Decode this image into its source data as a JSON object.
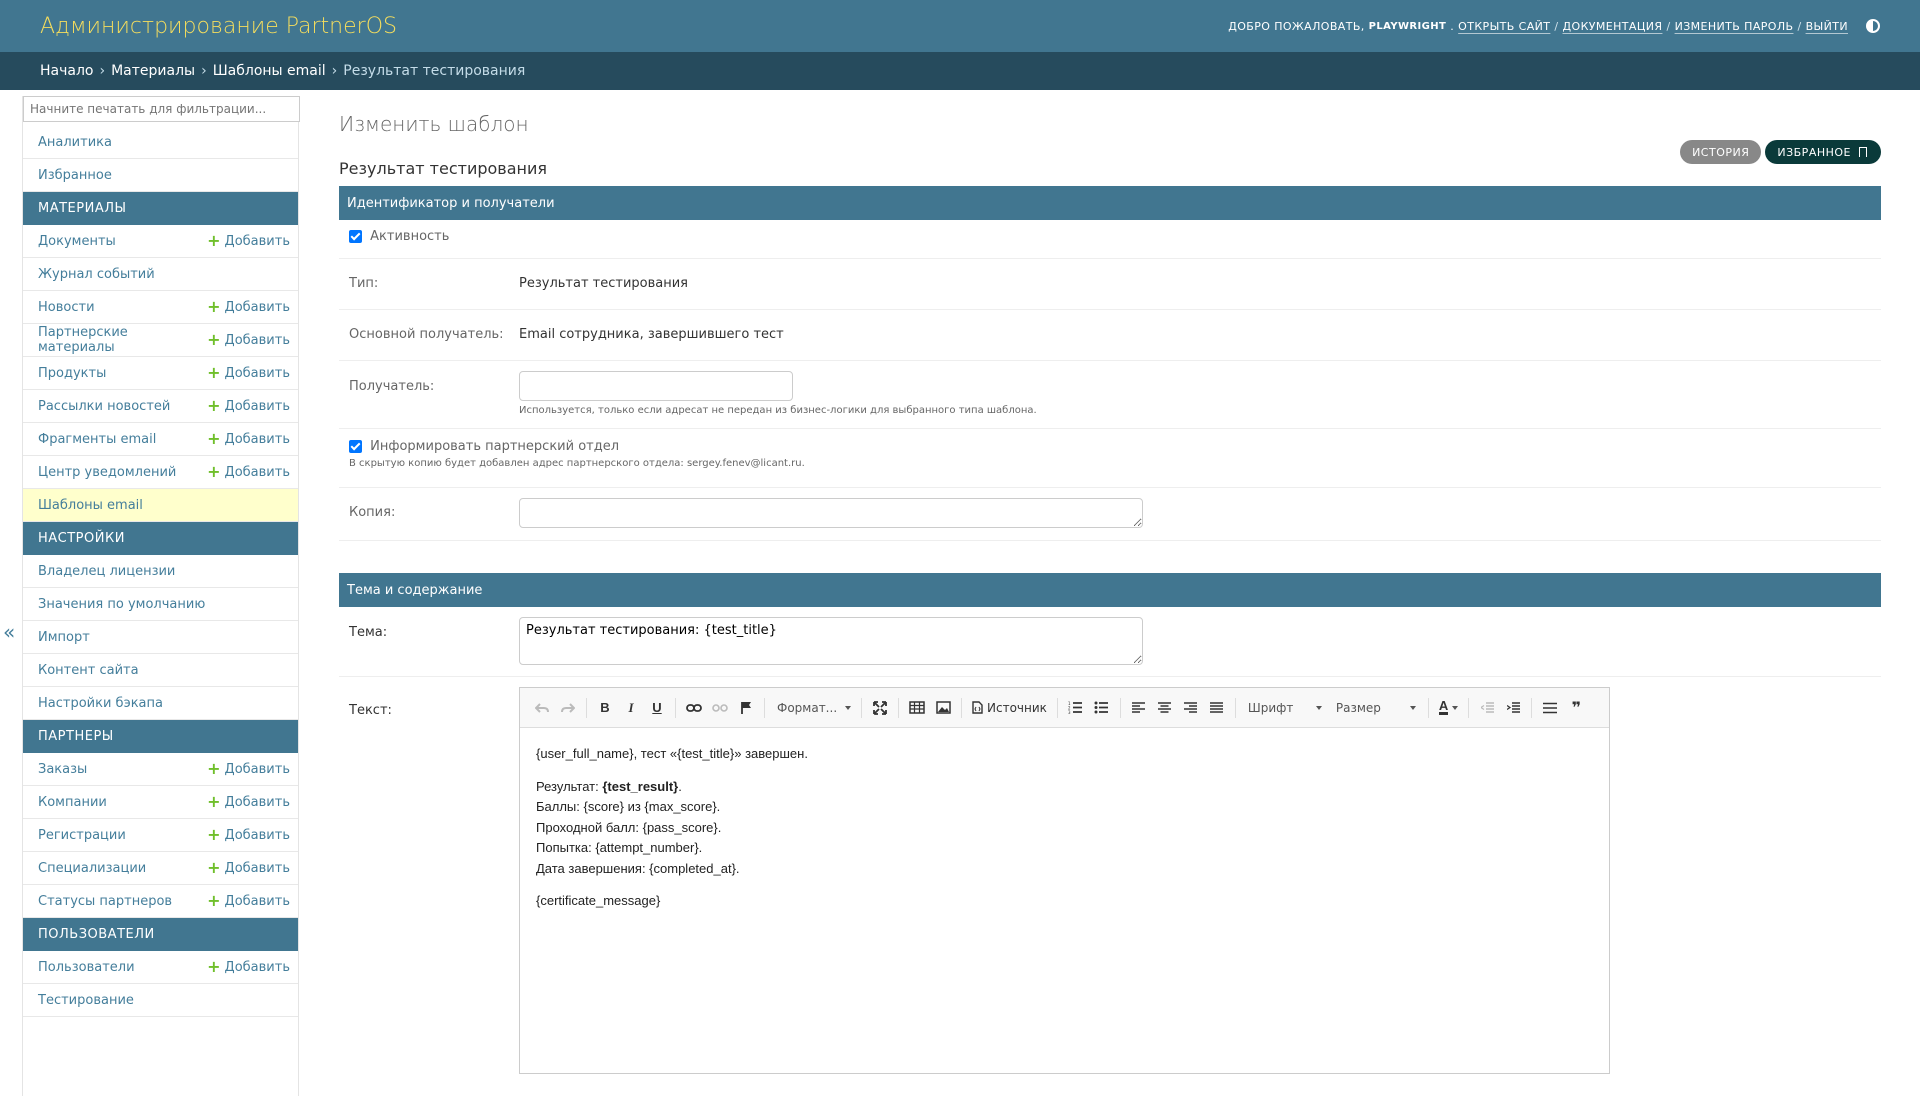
{
  "header": {
    "site_name": "Администрирование PartnerOS",
    "welcome": "Добро пожаловать,",
    "username": "PLAYWRIGHT",
    "links": [
      "Открыть сайт",
      "Документация",
      "Изменить пароль",
      "Выйти"
    ]
  },
  "breadcrumbs": [
    "Начало",
    "Материалы",
    "Шаблоны email",
    "Результат тестирования"
  ],
  "sidebar": {
    "filter_placeholder": "Начните печатать для фильтрации...",
    "add_label": "Добавить",
    "top_items": [
      {
        "label": "Аналитика"
      },
      {
        "label": "Избранное"
      }
    ],
    "sections": [
      {
        "title": "Материалы",
        "items": [
          {
            "label": "Документы",
            "add": true
          },
          {
            "label": "Журнал событий",
            "add": false
          },
          {
            "label": "Новости",
            "add": true
          },
          {
            "label": "Партнерские материалы",
            "add": true
          },
          {
            "label": "Продукты",
            "add": true
          },
          {
            "label": "Рассылки новостей",
            "add": true
          },
          {
            "label": "Фрагменты email",
            "add": true
          },
          {
            "label": "Центр уведомлений",
            "add": true
          },
          {
            "label": "Шаблоны email",
            "add": false,
            "current": true
          }
        ]
      },
      {
        "title": "Настройки",
        "items": [
          {
            "label": "Владелец лицензии",
            "add": false
          },
          {
            "label": "Значения по умолчанию",
            "add": false
          },
          {
            "label": "Импорт",
            "add": false
          },
          {
            "label": "Контент сайта",
            "add": false
          },
          {
            "label": "Настройки бэкапа",
            "add": false
          }
        ]
      },
      {
        "title": "Партнеры",
        "items": [
          {
            "label": "Заказы",
            "add": true
          },
          {
            "label": "Компании",
            "add": true
          },
          {
            "label": "Регистрации",
            "add": true
          },
          {
            "label": "Специализации",
            "add": true
          },
          {
            "label": "Статусы партнеров",
            "add": true
          }
        ]
      },
      {
        "title": "Пользователи",
        "items": [
          {
            "label": "Пользователи",
            "add": true
          },
          {
            "label": "Тестирование",
            "add": false
          }
        ]
      }
    ],
    "toggle": "«"
  },
  "content": {
    "title": "Изменить шаблон",
    "subtitle": "Результат тестирования",
    "object_tools": {
      "history": "История",
      "favorite": "Избранное"
    },
    "fieldset1": {
      "title": "Идентификатор и получатели",
      "active_label": "Активность",
      "active_checked": true,
      "type_label": "Тип:",
      "type_value": "Результат тестирования",
      "main_recipient_label": "Основной получатель:",
      "main_recipient_value": "Email сотрудника, завершившего тест",
      "recipient_label": "Получатель:",
      "recipient_value": "",
      "recipient_help": "Используется, только если адресат не передан из бизнес-логики для выбранного типа шаблона.",
      "inform_label": "Информировать партнерский отдел",
      "inform_checked": true,
      "inform_help": "В скрытую копию будет добавлен адрес партнерского отдела: sergey.fenev@licant.ru.",
      "cc_label": "Копия:",
      "cc_value": ""
    },
    "fieldset2": {
      "title": "Тема и содержание",
      "subject_label": "Тема:",
      "subject_value": "Результат тестирования: {test_title}",
      "text_label": "Текст:"
    }
  },
  "editor": {
    "toolbar": {
      "bold": "B",
      "italic": "I",
      "underline": "U",
      "format": "Формат...",
      "source": "Источник",
      "font": "Шрифт",
      "size": "Размер",
      "text_color": "A",
      "quote": "❞"
    },
    "body": {
      "line1": "{user_full_name}, тест «{test_title}» завершен.",
      "result_prefix": "Результат: ",
      "result_value": "{test_result}",
      "result_suffix": ".",
      "score": "Баллы: {score} из {max_score}.",
      "pass": "Проходной балл: {pass_score}.",
      "attempt": "Попытка: {attempt_number}.",
      "completed": "Дата завершения: {completed_at}.",
      "certificate": "{certificate_message}"
    }
  },
  "colors": {
    "header": "#417690",
    "breadcrumbs": "#264b5d",
    "site_name": "#f5dd5d",
    "link": "#447e9b",
    "add_plus": "#70bf2b",
    "current_row": "#ffffcc"
  }
}
